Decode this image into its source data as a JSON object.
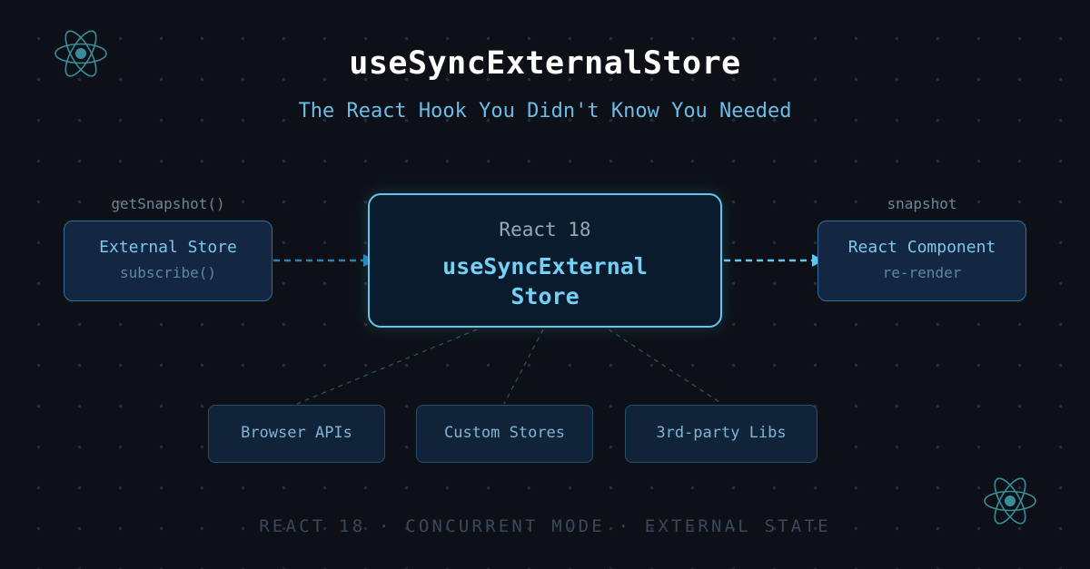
{
  "header": {
    "title": "useSyncExternalStore",
    "subtitle": "The React Hook You Didn't Know You Needed"
  },
  "left": {
    "edge_label": "getSnapshot()",
    "box_title": "External Store",
    "box_sub": "subscribe()"
  },
  "center": {
    "version": "React 18",
    "hook_name": "useSyncExternal Store"
  },
  "right": {
    "edge_label": "snapshot",
    "box_title": "React Component",
    "box_sub": "re-render"
  },
  "sources": [
    {
      "label": "Browser APIs"
    },
    {
      "label": "Custom Stores"
    },
    {
      "label": "3rd-party Libs"
    }
  ],
  "footer": "REACT 18 · CONCURRENT MODE · EXTERNAL STATE",
  "icons": {
    "corner": "react-atom-icon"
  },
  "colors": {
    "background": "#0d1117",
    "accent": "#5fc6ec",
    "box_fill": "#132743",
    "box_border": "#2f6ea0"
  }
}
